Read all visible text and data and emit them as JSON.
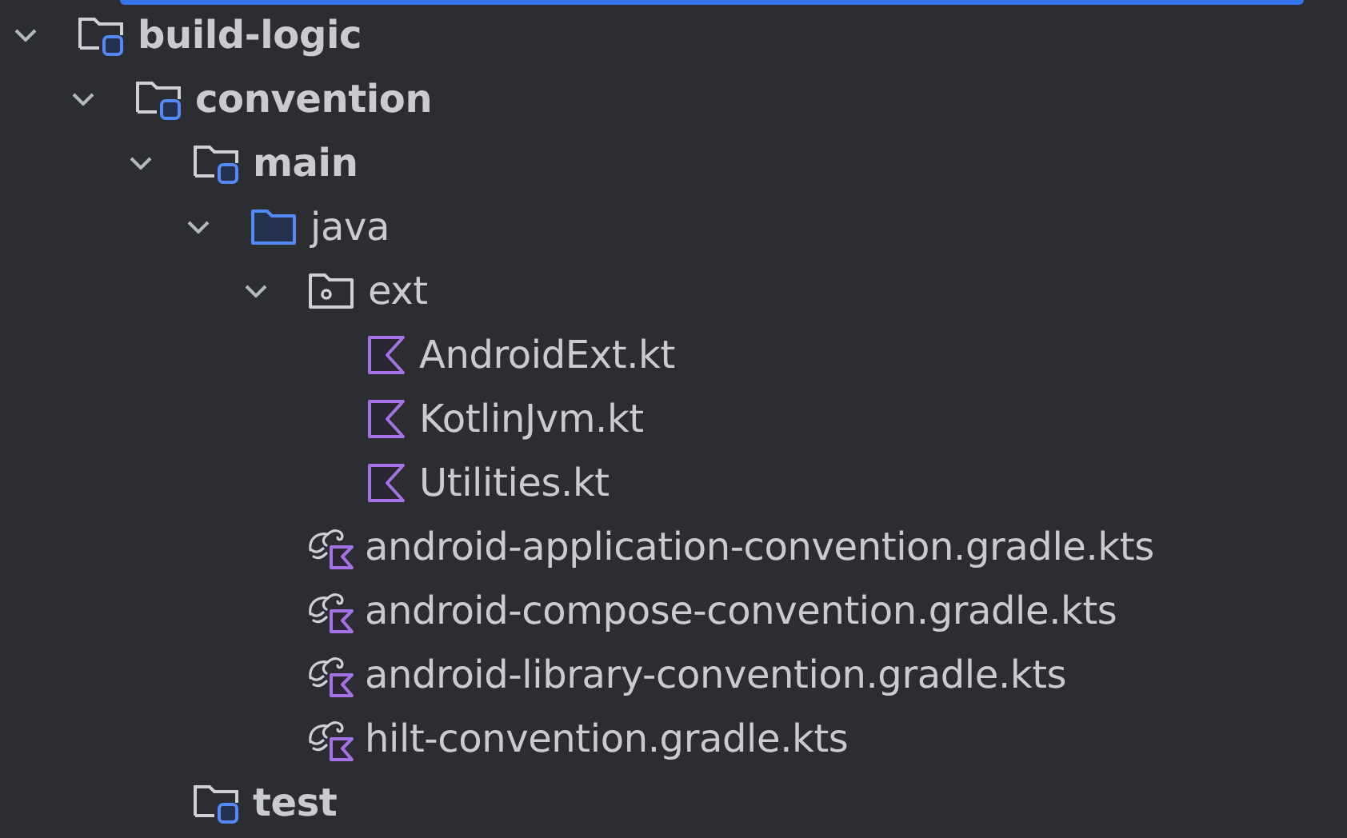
{
  "tree": [
    {
      "label": "build-logic",
      "kind": "module",
      "expanded": true,
      "children": [
        {
          "label": "convention",
          "kind": "module",
          "expanded": true,
          "children": [
            {
              "label": "main",
              "kind": "module",
              "expanded": true,
              "children": [
                {
                  "label": "java",
                  "kind": "source",
                  "expanded": true,
                  "children": [
                    {
                      "label": "ext",
                      "kind": "package",
                      "expanded": true,
                      "children": [
                        {
                          "label": "AndroidExt.kt",
                          "kind": "kotlin"
                        },
                        {
                          "label": "KotlinJvm.kt",
                          "kind": "kotlin"
                        },
                        {
                          "label": "Utilities.kt",
                          "kind": "kotlin"
                        }
                      ]
                    },
                    {
                      "label": "android-application-convention.gradle.kts",
                      "kind": "gradle"
                    },
                    {
                      "label": "android-compose-convention.gradle.kts",
                      "kind": "gradle"
                    },
                    {
                      "label": "android-library-convention.gradle.kts",
                      "kind": "gradle"
                    },
                    {
                      "label": "hilt-convention.gradle.kts",
                      "kind": "gradle"
                    }
                  ]
                }
              ]
            },
            {
              "label": "test",
              "kind": "module"
            }
          ]
        }
      ]
    }
  ]
}
